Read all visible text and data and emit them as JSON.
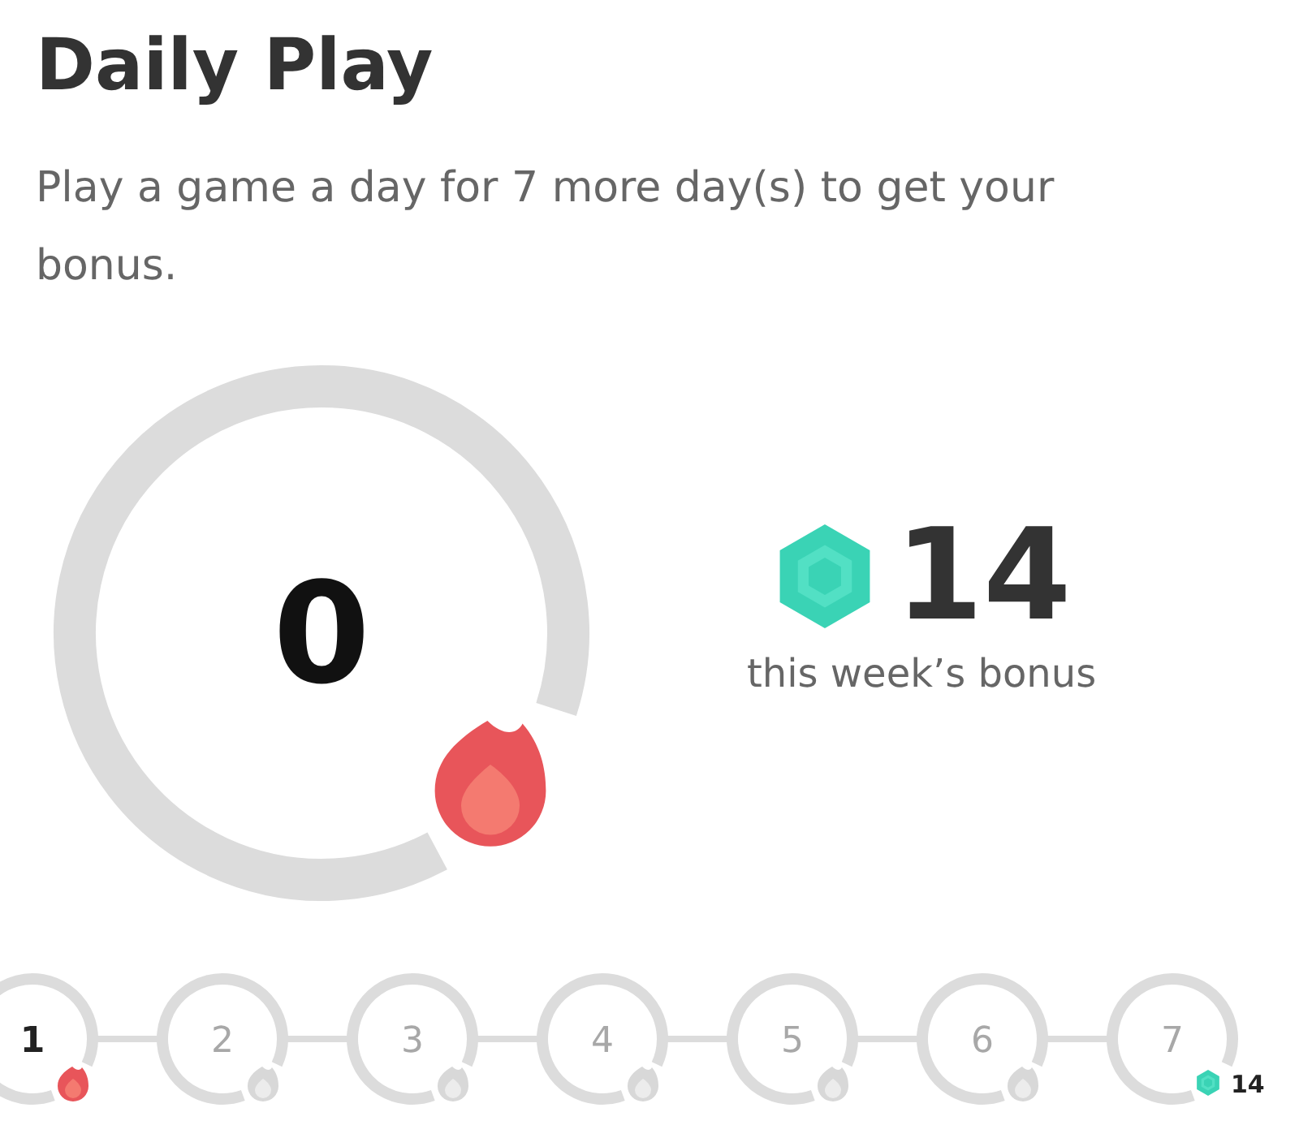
{
  "title": "Daily Play",
  "description": "Play a game a day for 7 more day(s) to get your bonus.",
  "streak": {
    "count": "0",
    "flame_lit": true
  },
  "bonus": {
    "amount": "14",
    "caption": "this week’s bonus"
  },
  "days": [
    {
      "label": "1",
      "active": true,
      "kind": "flame"
    },
    {
      "label": "2",
      "active": false,
      "kind": "flame"
    },
    {
      "label": "3",
      "active": false,
      "kind": "flame"
    },
    {
      "label": "4",
      "active": false,
      "kind": "flame"
    },
    {
      "label": "5",
      "active": false,
      "kind": "flame"
    },
    {
      "label": "6",
      "active": false,
      "kind": "flame"
    },
    {
      "label": "7",
      "active": false,
      "kind": "reward",
      "reward": "14"
    }
  ]
}
